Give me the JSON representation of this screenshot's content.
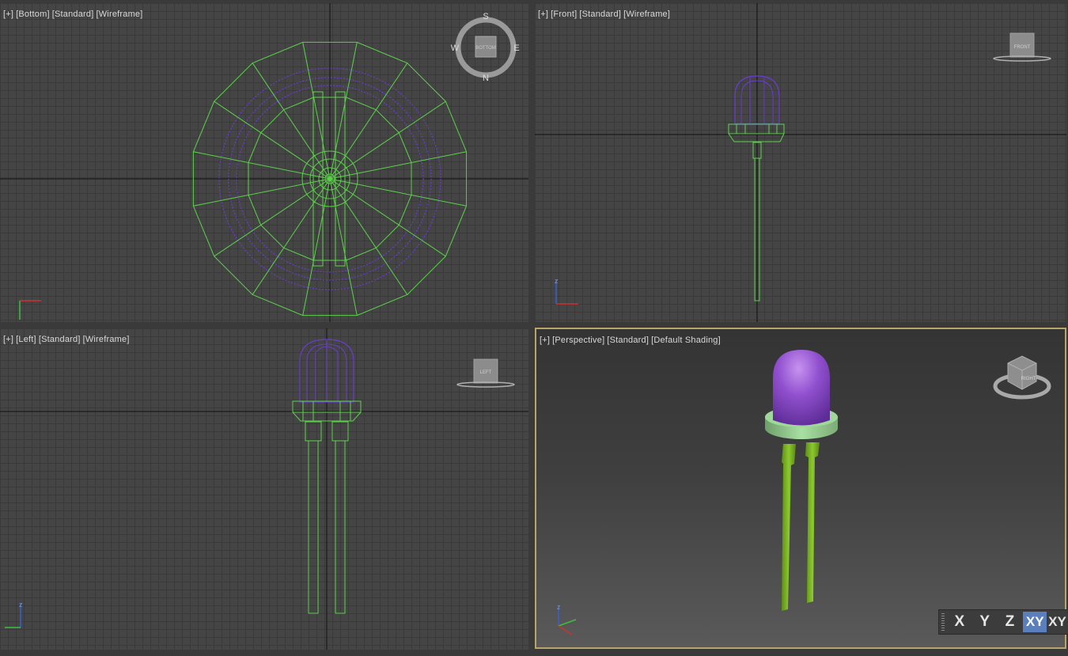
{
  "viewports": {
    "bottom": {
      "labels": [
        "[+]",
        "[Bottom]",
        "[Standard]",
        "[Wireframe]"
      ]
    },
    "front": {
      "labels": [
        "[+]",
        "[Front]",
        "[Standard]",
        "[Wireframe]"
      ]
    },
    "left": {
      "labels": [
        "[+]",
        "[Left]",
        "[Standard]",
        "[Wireframe]"
      ]
    },
    "perspective": {
      "labels": [
        "[+]",
        "[Perspective]",
        "[Standard]",
        "[Default Shading]"
      ]
    }
  },
  "viewcube": {
    "bottom": {
      "face": "BOTTOM",
      "compass": {
        "s": "S",
        "w": "W",
        "e": "E",
        "n": "N"
      }
    },
    "front": {
      "face": "FRONT"
    },
    "left": {
      "face": "LEFT"
    },
    "perspective": {
      "face": "RIGHT"
    }
  },
  "axis_constraints": {
    "buttons": [
      "X",
      "Y",
      "Z",
      "XY",
      "XY"
    ],
    "active": "XY"
  },
  "colors": {
    "wire_green": "#5bd24a",
    "wire_purple": "#6a3bd0",
    "bulb": "#8e4ec8",
    "base_ring": "#9fd89a",
    "legs": "#7fb828",
    "selected_border": "#b9a56a",
    "grid_line": "#3a3a3a",
    "grid_bg": "#454545"
  },
  "icons": [
    "viewcube-icon",
    "compass-icon",
    "axis-tripod-icon",
    "grip-icon"
  ]
}
